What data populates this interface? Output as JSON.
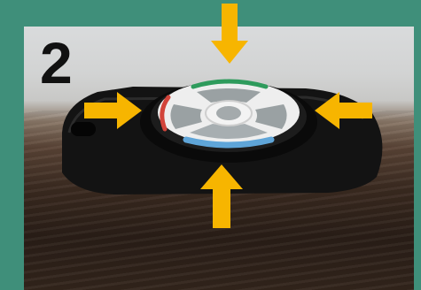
{
  "step": {
    "number": "2"
  },
  "colors": {
    "frame": "#3f8f7a",
    "arrow": "#f7b500",
    "remote_body": "#121212",
    "button_gray": "#9aa1a3",
    "ring_white": "#eeeeee",
    "accent_green": "#2e9b5c",
    "accent_red": "#d2443a",
    "accent_blue": "#5fa5d8"
  },
  "icons": [
    "arrow-down-icon",
    "arrow-right-icon",
    "arrow-left-icon",
    "arrow-up-icon"
  ]
}
